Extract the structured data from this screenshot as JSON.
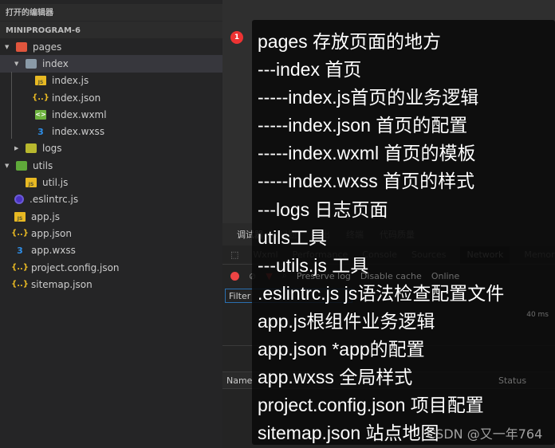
{
  "sidebar": {
    "open_editors": "打开的编辑器",
    "project": "MINIPROGRAM-6",
    "items": [
      {
        "label": "pages",
        "icon": "folder-pages-icon",
        "expanded": true
      },
      {
        "label": "index",
        "icon": "folder-icon",
        "expanded": true,
        "selected": true
      },
      {
        "label": "index.js",
        "icon": "js-file-icon"
      },
      {
        "label": "index.json",
        "icon": "json-file-icon"
      },
      {
        "label": "index.wxml",
        "icon": "wxml-file-icon"
      },
      {
        "label": "index.wxss",
        "icon": "wxss-file-icon"
      },
      {
        "label": "logs",
        "icon": "folder-icon",
        "expanded": false
      },
      {
        "label": "utils",
        "icon": "folder-utils-icon",
        "expanded": true
      },
      {
        "label": "util.js",
        "icon": "js-file-icon"
      },
      {
        "label": ".eslintrc.js",
        "icon": "eslint-icon"
      },
      {
        "label": "app.js",
        "icon": "js-file-icon"
      },
      {
        "label": "app.json",
        "icon": "json-file-icon"
      },
      {
        "label": "app.wxss",
        "icon": "wxss-file-icon"
      },
      {
        "label": "project.config.json",
        "icon": "json-file-icon"
      },
      {
        "label": "sitemap.json",
        "icon": "json-file-icon"
      }
    ]
  },
  "devtools": {
    "tabs": [
      "调试器",
      "问题",
      "输出",
      "终端",
      "代码质量"
    ],
    "panels": [
      "Wxml",
      "Performance",
      "Console",
      "Sources",
      "Network",
      "Memory"
    ],
    "active_panel": "Network",
    "preserve_log": "Preserve log",
    "disable_cache": "Disable cache",
    "throttle": "Online",
    "filter_placeholder": "Filter",
    "time_label": "40 ms",
    "col_name": "Name",
    "col_status": "Status"
  },
  "annotation": {
    "badge": "1",
    "lines": [
      "pages 存放页面的地方",
      "---index 首页",
      "-----index.js首页的业务逻辑",
      "-----index.json 首页的配置",
      "-----index.wxml 首页的模板",
      "-----index.wxss 首页的样式",
      "---logs 日志页面",
      "utils工具",
      "---utils.js 工具",
      ".eslintrc.js js语法检查配置文件",
      "app.js根组件业务逻辑",
      "app.json *app的配置",
      "app.wxss 全局样式",
      "project.config.json 项目配置",
      "sitemap.json 站点地图"
    ]
  },
  "watermark": "CSDN @又一年764",
  "colors": {
    "badge": "#e33333",
    "sidebar_bg": "#252526",
    "tooltip_bg": "#111111"
  }
}
